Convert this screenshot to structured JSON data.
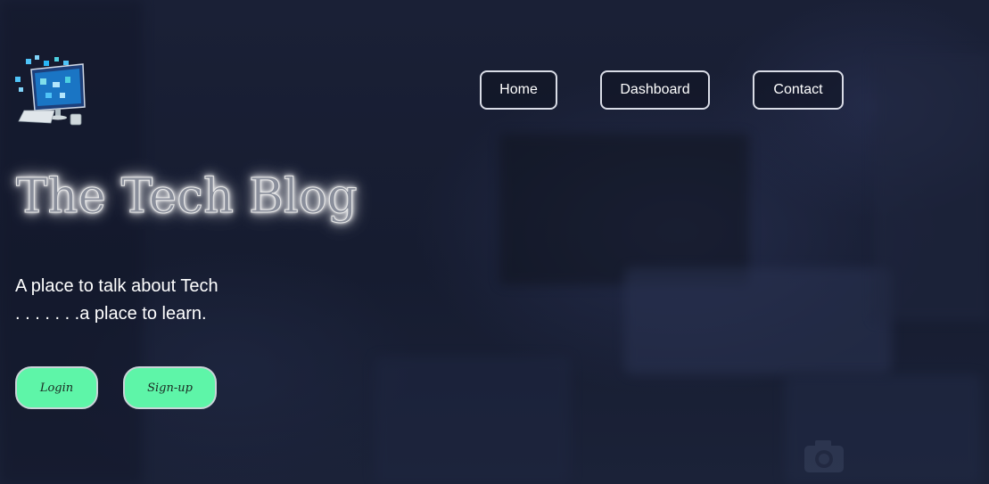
{
  "header": {
    "logo_icon": "computer-devices-logo-icon",
    "nav": [
      {
        "label": "Home"
      },
      {
        "label": "Dashboard"
      },
      {
        "label": "Contact"
      }
    ]
  },
  "hero": {
    "title": "The Tech Blog",
    "tagline_line1": "A place to talk about Tech",
    "tagline_line2": ". . . . . . .a place to learn.",
    "buttons": {
      "login_label": "Login",
      "signup_label": "Sign-up"
    }
  },
  "colors": {
    "background": "#161c30",
    "nav_border": "#d9dce6",
    "cta_fill": "#5ef5a8",
    "title_glow": "#ffffff"
  }
}
